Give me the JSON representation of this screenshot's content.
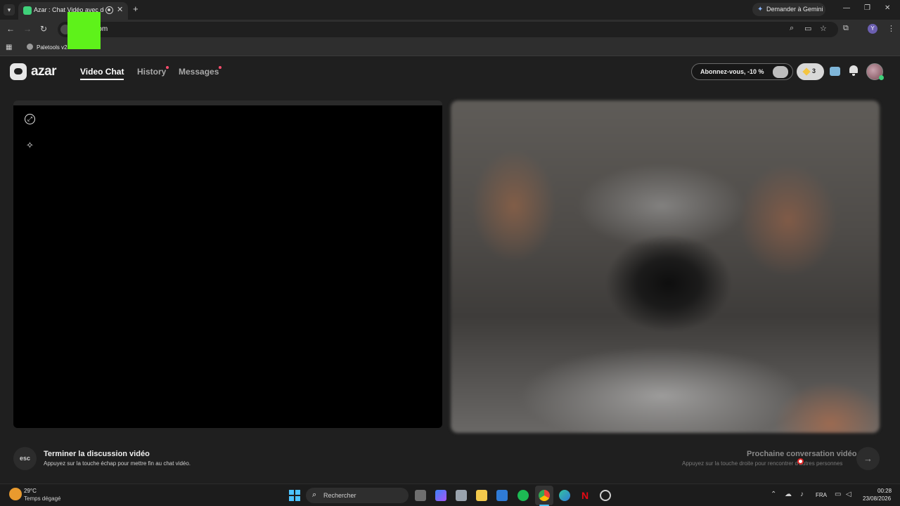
{
  "browser": {
    "tab_title": "Azar : Chat Vidéo avec de n",
    "tab_close": "✕",
    "new_tab": "+",
    "gemini_label": "Demander à Gemini",
    "window_controls": [
      "—",
      "❐",
      "✕"
    ],
    "url": "e.com",
    "bookmark_label": "Paletools v2"
  },
  "app": {
    "logo_text": "azar",
    "nav": {
      "video_chat": "Video Chat",
      "history": "History",
      "messages": "Messages"
    },
    "promo_label": "Abonnez-vous, -10 %",
    "gem_count": "3",
    "controls": {
      "end": {
        "key_label": "esc",
        "title": "Terminer la discussion vidéo",
        "subtitle": "Appuyez sur la touche échap pour mettre fin au chat vidéo."
      },
      "next": {
        "title": "Prochaine conversation vidéo",
        "subtitle": "Appuyez sur la touche droite pour rencontrer d'autres personnes",
        "arrow": "→"
      }
    }
  },
  "taskbar": {
    "temperature": "29°C",
    "weather": "Temps dégagé",
    "search_label": "Rechercher",
    "language": "FRA",
    "time": "00:28",
    "date": "23/08/2026"
  },
  "colors": {
    "accent_blue": "#4cc2ff",
    "notification_dot": "#ff4d6d",
    "marker_green": "#5ef21a"
  }
}
